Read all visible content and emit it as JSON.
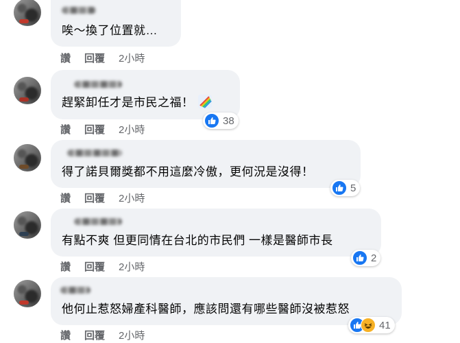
{
  "actions": {
    "like": "讚",
    "reply": "回覆"
  },
  "comments": [
    {
      "text": "唉～換了位置就…",
      "time": "2小時",
      "reaction_count": "",
      "reactions": []
    },
    {
      "text": "趕緊卸任才是市民之福！",
      "emoji": "rainbow-icon",
      "time": "2小時",
      "reaction_count": "38",
      "reactions": [
        "like"
      ]
    },
    {
      "text": "得了諾貝爾獎都不用這麼冷傲，更何況是沒得！",
      "time": "2小時",
      "reaction_count": "5",
      "reactions": [
        "like"
      ]
    },
    {
      "text": "有點不爽 但更同情在台北的市民們 一樣是醫師市長",
      "time": "2小時",
      "reaction_count": "2",
      "reactions": [
        "like"
      ]
    },
    {
      "text": "他何止惹怒婦產科醫師，應該問還有哪些醫師沒被惹怒",
      "time": "2小時",
      "reaction_count": "41",
      "reactions": [
        "like",
        "haha"
      ]
    }
  ],
  "colors": {
    "like": "#1877f2",
    "haha": "#f7b125",
    "bubble": "#f0f2f5",
    "meta_text": "#65676b"
  }
}
